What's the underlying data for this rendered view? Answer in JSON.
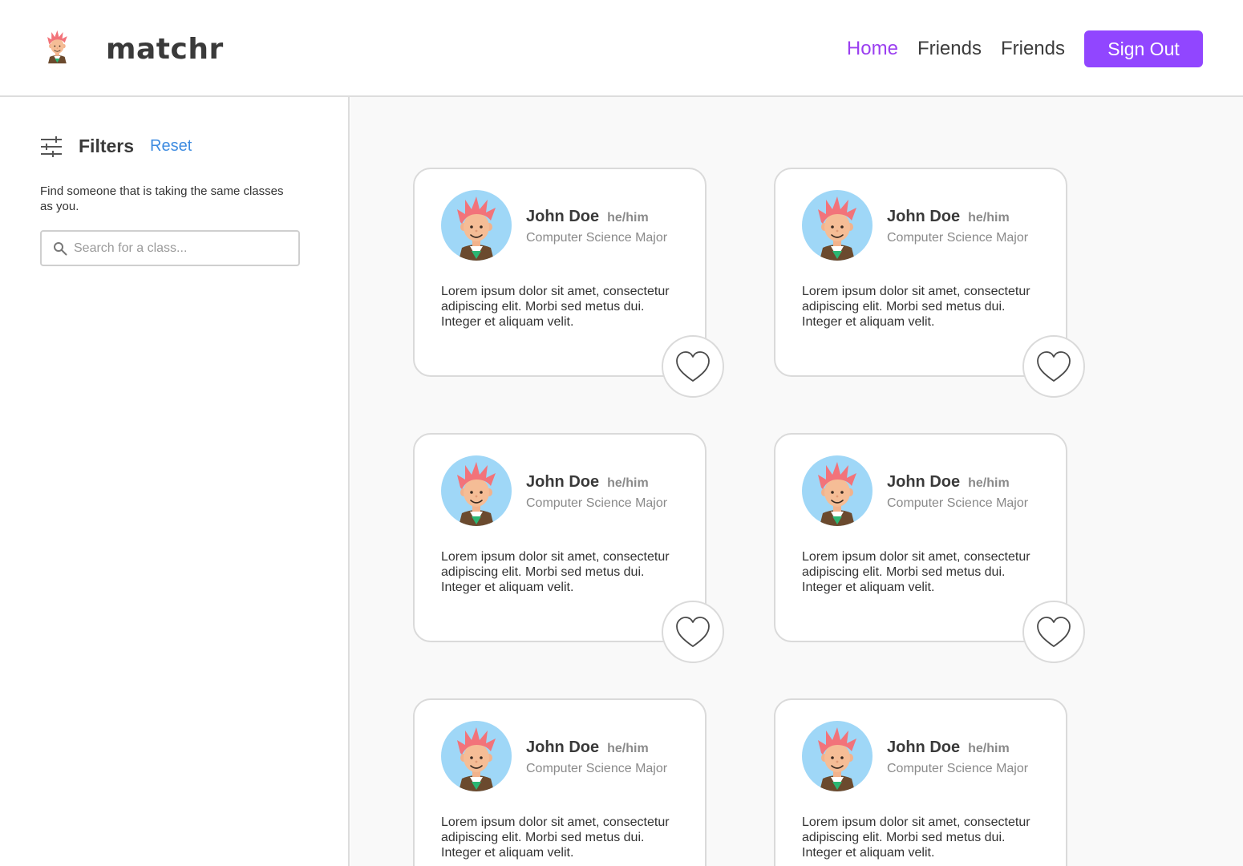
{
  "brand": {
    "name": "matchr",
    "logo_icon": "cartoon-boy-logo-icon"
  },
  "nav": {
    "links": [
      {
        "label": "Home",
        "active": true
      },
      {
        "label": "Friends",
        "active": false
      },
      {
        "label": "Friends",
        "active": false
      }
    ],
    "signout_label": "Sign Out"
  },
  "sidebar": {
    "filters_icon": "sliders-icon",
    "title": "Filters",
    "reset_label": "Reset",
    "description": "Find someone that is taking the same classes as you.",
    "search": {
      "placeholder": "Search for a class...",
      "value": "",
      "icon": "search-icon"
    }
  },
  "cards": [
    {
      "name": "John Doe",
      "pronouns": "he/him",
      "major": "Computer Science Major",
      "bio": "Lorem ipsum dolor sit amet, consectetur adipiscing elit. Morbi sed metus dui. Integer et aliquam velit."
    },
    {
      "name": "John Doe",
      "pronouns": "he/him",
      "major": "Computer Science Major",
      "bio": "Lorem ipsum dolor sit amet, consectetur adipiscing elit. Morbi sed metus dui. Integer et aliquam velit."
    },
    {
      "name": "John Doe",
      "pronouns": "he/him",
      "major": "Computer Science Major",
      "bio": "Lorem ipsum dolor sit amet, consectetur adipiscing elit. Morbi sed metus dui. Integer et aliquam velit."
    },
    {
      "name": "John Doe",
      "pronouns": "he/him",
      "major": "Computer Science Major",
      "bio": "Lorem ipsum dolor sit amet, consectetur adipiscing elit. Morbi sed metus dui. Integer et aliquam velit."
    },
    {
      "name": "John Doe",
      "pronouns": "he/him",
      "major": "Computer Science Major",
      "bio": "Lorem ipsum dolor sit amet, consectetur adipiscing elit. Morbi sed metus dui. Integer et aliquam velit."
    },
    {
      "name": "John Doe",
      "pronouns": "he/him",
      "major": "Computer Science Major",
      "bio": "Lorem ipsum dolor sit amet, consectetur adipiscing elit. Morbi sed metus dui. Integer et aliquam velit."
    }
  ],
  "colors": {
    "accent": "#9146ff",
    "active_nav": "#9b3ff0",
    "link": "#3d8be0",
    "avatar_bg": "#9fd7f7"
  }
}
